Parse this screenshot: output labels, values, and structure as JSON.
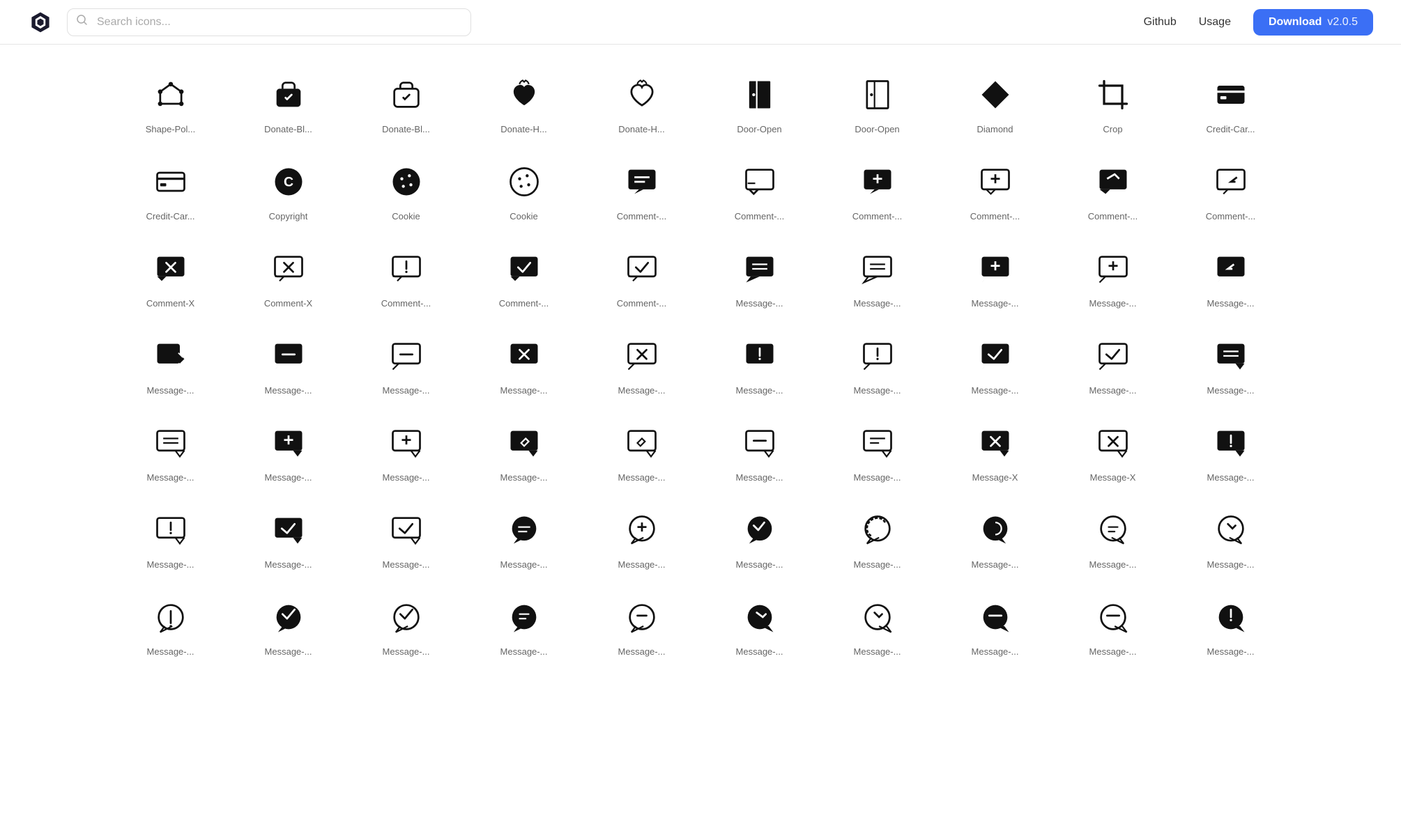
{
  "header": {
    "logo_alt": "Phosphor Icons Logo",
    "search_placeholder": "Search icons...",
    "nav": {
      "github": "Github",
      "usage": "Usage"
    },
    "download": {
      "label": "Download",
      "version": "v2.0.5"
    }
  },
  "icons": [
    {
      "id": "shape-pol",
      "label": "Shape-Pol...",
      "type": "shape-polygon"
    },
    {
      "id": "donate-bl1",
      "label": "Donate-Bl...",
      "type": "donate-bl1"
    },
    {
      "id": "donate-bl2",
      "label": "Donate-Bl...",
      "type": "donate-bl2"
    },
    {
      "id": "donate-h1",
      "label": "Donate-H...",
      "type": "donate-h1"
    },
    {
      "id": "donate-h2",
      "label": "Donate-H...",
      "type": "donate-h2"
    },
    {
      "id": "door-open1",
      "label": "Door-Open",
      "type": "door-open1"
    },
    {
      "id": "door-open2",
      "label": "Door-Open",
      "type": "door-open2"
    },
    {
      "id": "diamond",
      "label": "Diamond",
      "type": "diamond"
    },
    {
      "id": "crop",
      "label": "Crop",
      "type": "crop"
    },
    {
      "id": "credit-car1",
      "label": "Credit-Car...",
      "type": "credit-car1"
    },
    {
      "id": "credit-car2",
      "label": "Credit-Car...",
      "type": "credit-car2"
    },
    {
      "id": "copyright",
      "label": "Copyright",
      "type": "copyright"
    },
    {
      "id": "cookie1",
      "label": "Cookie",
      "type": "cookie1"
    },
    {
      "id": "cookie2",
      "label": "Cookie",
      "type": "cookie2"
    },
    {
      "id": "comment1",
      "label": "Comment-...",
      "type": "comment1"
    },
    {
      "id": "comment2",
      "label": "Comment-...",
      "type": "comment2"
    },
    {
      "id": "comment3",
      "label": "Comment-...",
      "type": "comment3"
    },
    {
      "id": "comment4",
      "label": "Comment-...",
      "type": "comment4"
    },
    {
      "id": "comment5",
      "label": "Comment-...",
      "type": "comment5"
    },
    {
      "id": "comment6",
      "label": "Comment-...",
      "type": "comment6"
    },
    {
      "id": "comment-x1",
      "label": "Comment-X",
      "type": "comment-x1"
    },
    {
      "id": "comment-x2",
      "label": "Comment-X",
      "type": "comment-x2"
    },
    {
      "id": "comment-ex",
      "label": "Comment-...",
      "type": "comment-ex"
    },
    {
      "id": "comment-check1",
      "label": "Comment-...",
      "type": "comment-check1"
    },
    {
      "id": "comment-check2",
      "label": "Comment-...",
      "type": "comment-check2"
    },
    {
      "id": "message1",
      "label": "Message-...",
      "type": "message1"
    },
    {
      "id": "message2",
      "label": "Message-...",
      "type": "message2"
    },
    {
      "id": "message3",
      "label": "Message-...",
      "type": "message3"
    },
    {
      "id": "message4",
      "label": "Message-...",
      "type": "message4"
    },
    {
      "id": "message5",
      "label": "Message-...",
      "type": "message5"
    },
    {
      "id": "message-pen1",
      "label": "Message-...",
      "type": "message-pen1"
    },
    {
      "id": "message-minus1",
      "label": "Message-...",
      "type": "message-minus1"
    },
    {
      "id": "message-minus2",
      "label": "Message-...",
      "type": "message-minus2"
    },
    {
      "id": "message-x1",
      "label": "Message-...",
      "type": "message-x1"
    },
    {
      "id": "message-x2",
      "label": "Message-...",
      "type": "message-x2"
    },
    {
      "id": "message-exc1",
      "label": "Message-...",
      "type": "message-exc1"
    },
    {
      "id": "message-exc2",
      "label": "Message-...",
      "type": "message-exc2"
    },
    {
      "id": "message-check1",
      "label": "Message-...",
      "type": "message-check1"
    },
    {
      "id": "message-check2",
      "label": "Message-...",
      "type": "message-check2"
    },
    {
      "id": "message-lines1",
      "label": "Message-...",
      "type": "message-lines1"
    },
    {
      "id": "message-lines2",
      "label": "Message-...",
      "type": "message-lines2"
    },
    {
      "id": "message-plus1",
      "label": "Message-...",
      "type": "message-plus1"
    },
    {
      "id": "message-plus2",
      "label": "Message-...",
      "type": "message-plus2"
    },
    {
      "id": "message-pen2",
      "label": "Message-...",
      "type": "message-pen2"
    },
    {
      "id": "message-pen3",
      "label": "Message-...",
      "type": "message-pen3"
    },
    {
      "id": "message-minus3",
      "label": "Message-...",
      "type": "message-minus3"
    },
    {
      "id": "message-lines3",
      "label": "Message-...",
      "type": "message-lines3"
    },
    {
      "id": "message-xmark1",
      "label": "Message-X",
      "type": "message-xmark1"
    },
    {
      "id": "message-xmark2",
      "label": "Message-X",
      "type": "message-xmark2"
    },
    {
      "id": "message-exc3",
      "label": "Message-...",
      "type": "message-exc3"
    },
    {
      "id": "message-exc4",
      "label": "Message-...",
      "type": "message-exc4"
    },
    {
      "id": "message-check3",
      "label": "Message-...",
      "type": "message-check3"
    },
    {
      "id": "message-check4",
      "label": "Message-...",
      "type": "message-check4"
    },
    {
      "id": "chat-circle1",
      "label": "Message-...",
      "type": "chat-circle1"
    },
    {
      "id": "chat-circle2",
      "label": "Message-...",
      "type": "chat-circle2"
    },
    {
      "id": "chat-circle3",
      "label": "Message-...",
      "type": "chat-circle3"
    },
    {
      "id": "chat-circle4",
      "label": "Message-...",
      "type": "chat-circle4"
    },
    {
      "id": "chat-circle5",
      "label": "Message-...",
      "type": "chat-circle5"
    },
    {
      "id": "chat-circle6",
      "label": "Message-...",
      "type": "chat-circle6"
    },
    {
      "id": "chat-circle7",
      "label": "Message-...",
      "type": "chat-circle7"
    },
    {
      "id": "partial1",
      "label": "Message-...",
      "type": "partial1"
    },
    {
      "id": "partial2",
      "label": "Message-...",
      "type": "partial2"
    },
    {
      "id": "partial3",
      "label": "Message-...",
      "type": "partial3"
    },
    {
      "id": "partial4",
      "label": "Message-...",
      "type": "partial4"
    },
    {
      "id": "partial5",
      "label": "Message-...",
      "type": "partial5"
    },
    {
      "id": "partial6",
      "label": "Message-...",
      "type": "partial6"
    },
    {
      "id": "partial7",
      "label": "Message-...",
      "type": "partial7"
    },
    {
      "id": "partial8",
      "label": "Message-...",
      "type": "partial8"
    },
    {
      "id": "partial9",
      "label": "Message-...",
      "type": "partial9"
    },
    {
      "id": "partial10",
      "label": "Message-...",
      "type": "partial10"
    }
  ]
}
